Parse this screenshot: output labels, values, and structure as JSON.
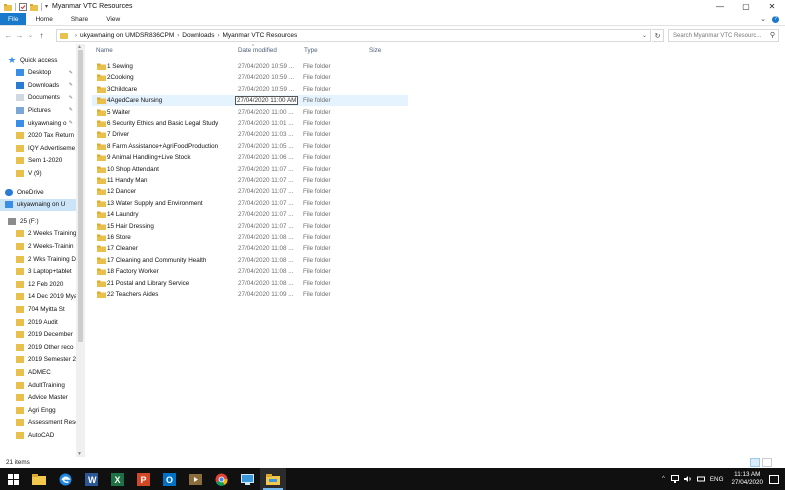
{
  "window": {
    "title": "Myanmar VTC Resources",
    "controls": [
      "—",
      "▢",
      "✕"
    ]
  },
  "ribbon": {
    "tabs": [
      "File",
      "Home",
      "Share",
      "View"
    ],
    "expand_glyph": "⌄",
    "help_glyph": "?"
  },
  "address": {
    "breadcrumbs": [
      "ukyawnaing on UMDSR836CPM",
      "Downloads",
      "Myanmar VTC Resources"
    ],
    "search_placeholder": "Search Myanmar VTC Resourc...",
    "dropdown_glyph": "⌄",
    "refresh_glyph": "↻",
    "search_glyph": "⚲"
  },
  "nav_glyphs": {
    "back": "←",
    "forward": "→",
    "recent": "⌄",
    "up": "↑"
  },
  "navpane": {
    "items": [
      {
        "label": "Quick access",
        "icon": "star-icon",
        "pinned": false,
        "selected": false
      },
      {
        "label": "Desktop",
        "icon": "desktop-icon",
        "pinned": true,
        "selected": false
      },
      {
        "label": "Downloads",
        "icon": "download-icon",
        "pinned": true,
        "selected": false
      },
      {
        "label": "Documents",
        "icon": "document-icon",
        "pinned": true,
        "selected": false
      },
      {
        "label": "Pictures",
        "icon": "picture-icon",
        "pinned": true,
        "selected": false
      },
      {
        "label": "ukyawnaing o",
        "icon": "computer-icon",
        "pinned": true,
        "selected": false
      },
      {
        "label": "2020 Tax Return",
        "icon": "folder-icon",
        "pinned": false,
        "selected": false
      },
      {
        "label": "IQY Advertiseme",
        "icon": "folder-icon",
        "pinned": false,
        "selected": false
      },
      {
        "label": "Sem 1-2020",
        "icon": "folder-icon",
        "pinned": false,
        "selected": false
      },
      {
        "label": "V (9)",
        "icon": "folder-icon",
        "pinned": false,
        "selected": false
      },
      {
        "label": "OneDrive",
        "icon": "cloud-icon",
        "pinned": false,
        "selected": false
      },
      {
        "label": "ukyawnaing on U",
        "icon": "computer-icon",
        "pinned": false,
        "selected": true
      },
      {
        "label": "25 (F:)",
        "icon": "drive-icon",
        "pinned": false,
        "selected": false
      },
      {
        "label": "2 Weeks Training",
        "icon": "folder-icon",
        "pinned": false,
        "selected": false
      },
      {
        "label": "2 Weeks-Trainin",
        "icon": "folder-icon",
        "pinned": false,
        "selected": false
      },
      {
        "label": "2 Wks Training D",
        "icon": "folder-icon",
        "pinned": false,
        "selected": false
      },
      {
        "label": "3 Laptop+tablet",
        "icon": "folder-icon",
        "pinned": false,
        "selected": false
      },
      {
        "label": "12 Feb 2020",
        "icon": "folder-icon",
        "pinned": false,
        "selected": false
      },
      {
        "label": "14 Dec 2019 Mya",
        "icon": "folder-icon",
        "pinned": false,
        "selected": false
      },
      {
        "label": "704 Myitta St",
        "icon": "folder-icon",
        "pinned": false,
        "selected": false
      },
      {
        "label": "2019 Audit",
        "icon": "folder-icon",
        "pinned": false,
        "selected": false
      },
      {
        "label": "2019 December",
        "icon": "folder-icon",
        "pinned": false,
        "selected": false
      },
      {
        "label": "2019 Other reco",
        "icon": "folder-icon",
        "pinned": false,
        "selected": false
      },
      {
        "label": "2019 Semester 2",
        "icon": "folder-icon",
        "pinned": false,
        "selected": false
      },
      {
        "label": "ADMEC",
        "icon": "folder-icon",
        "pinned": false,
        "selected": false
      },
      {
        "label": "AdultTraining",
        "icon": "folder-icon",
        "pinned": false,
        "selected": false
      },
      {
        "label": "Advice Master",
        "icon": "folder-icon",
        "pinned": false,
        "selected": false
      },
      {
        "label": "Agri Engg",
        "icon": "folder-icon",
        "pinned": false,
        "selected": false
      },
      {
        "label": "Assessment Reso",
        "icon": "folder-icon",
        "pinned": false,
        "selected": false
      },
      {
        "label": "AutoCAD",
        "icon": "folder-icon",
        "pinned": false,
        "selected": false
      }
    ],
    "pin_glyph": "✎"
  },
  "list": {
    "columns": {
      "name": "Name",
      "date": "Date modified",
      "type": "Type",
      "size": "Size"
    },
    "sort_glyph": "^",
    "rows": [
      {
        "name": "1 Sewing",
        "date": "27/04/2020 10:59 ...",
        "type": "File folder"
      },
      {
        "name": "2Cooking",
        "date": "27/04/2020 10:59 ...",
        "type": "File folder"
      },
      {
        "name": "3Childcare",
        "date": "27/04/2020 10:59 ...",
        "type": "File folder"
      },
      {
        "name": "4AgedCare Nursing",
        "date": "27/04/2020 11:00 AM",
        "type": "File folder"
      },
      {
        "name": "5 Waiter",
        "date": "27/04/2020 11:00 ...",
        "type": "File folder"
      },
      {
        "name": "6 Security  Ethics and Basic Legal Study",
        "date": "27/04/2020 11:01 ...",
        "type": "File folder"
      },
      {
        "name": "7 Driver",
        "date": "27/04/2020 11:03 ...",
        "type": "File folder"
      },
      {
        "name": "8 Farm Assistance+AgriFoodProduction",
        "date": "27/04/2020 11:05 ...",
        "type": "File folder"
      },
      {
        "name": "9 Animal Handling+Live Stock",
        "date": "27/04/2020 11:06 ...",
        "type": "File folder"
      },
      {
        "name": "10 Shop Attendant",
        "date": "27/04/2020 11:07 ...",
        "type": "File folder"
      },
      {
        "name": "11 Handy Man",
        "date": "27/04/2020 11:07 ...",
        "type": "File folder"
      },
      {
        "name": "12 Dancer",
        "date": "27/04/2020 11:07 ...",
        "type": "File folder"
      },
      {
        "name": "13 Water Supply and Environment",
        "date": "27/04/2020 11:07 ...",
        "type": "File folder"
      },
      {
        "name": "14 Laundry",
        "date": "27/04/2020 11:07 ...",
        "type": "File folder"
      },
      {
        "name": "15 Hair Dressing",
        "date": "27/04/2020 11:07 ...",
        "type": "File folder"
      },
      {
        "name": "16 Store",
        "date": "27/04/2020 11:08 ...",
        "type": "File folder"
      },
      {
        "name": "17 Cleaner",
        "date": "27/04/2020 11:08 ...",
        "type": "File folder"
      },
      {
        "name": "17 Cleaning and Community Health",
        "date": "27/04/2020 11:08 ...",
        "type": "File folder"
      },
      {
        "name": "18 Factory Worker",
        "date": "27/04/2020 11:08 ...",
        "type": "File folder"
      },
      {
        "name": "21 Postal and Library Service",
        "date": "27/04/2020 11:08 ...",
        "type": "File folder"
      },
      {
        "name": "22 Teachers Aides",
        "date": "27/04/2020 11:09 ...",
        "type": "File folder"
      }
    ],
    "hovered_index": 3
  },
  "status": {
    "item_count": "21 items"
  },
  "taskbar": {
    "apps": [
      "start-icon",
      "search-icon",
      "edge-icon",
      "word-icon",
      "excel-icon",
      "powerpoint-icon",
      "outlook-icon",
      "media-icon",
      "chrome-icon",
      "remote-desktop-icon",
      "file-explorer-icon"
    ],
    "tray_expand_glyph": "^",
    "language": "ENG",
    "time": "11:13 AM",
    "date": "27/04/2020"
  },
  "colors": {
    "accent": "#1979ca",
    "folder": "#e8c04b",
    "selection": "#cce4f7",
    "hover": "#e5f3ff",
    "taskbar": "#101010"
  }
}
